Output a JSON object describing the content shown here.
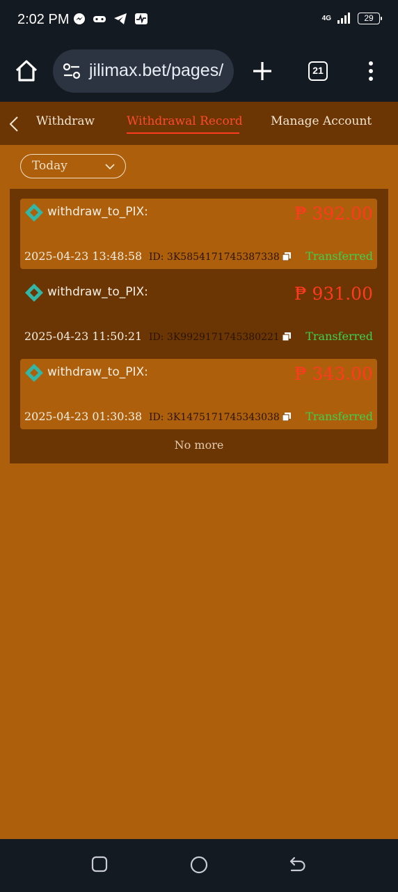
{
  "status_bar": {
    "time": "2:02 PM",
    "network": "4G",
    "battery": "29",
    "notification_icons": [
      "messenger-icon",
      "gamepad-icon",
      "telegram-icon",
      "activity-icon"
    ]
  },
  "browser": {
    "url": "jilimax.bet/pages/",
    "tab_count": "21"
  },
  "header": {
    "tabs": [
      {
        "label": "Withdraw"
      },
      {
        "label": "Withdrawal Record"
      },
      {
        "label": "Manage Account"
      }
    ],
    "active_tab": 1
  },
  "filter": {
    "selected": "Today"
  },
  "records": [
    {
      "method": "withdraw_to_PIX:",
      "amount": "₱ 392.00",
      "datetime": "2025-04-23 13:48:58",
      "id": "ID: 3K5854171745387338",
      "status": "Transferred"
    },
    {
      "method": "withdraw_to_PIX:",
      "amount": "₱ 931.00",
      "datetime": "2025-04-23 11:50:21",
      "id": "ID: 3K9929171745380221",
      "status": "Transferred"
    },
    {
      "method": "withdraw_to_PIX:",
      "amount": "₱ 343.00",
      "datetime": "2025-04-23 01:30:38",
      "id": "ID: 3K1475171745343038",
      "status": "Transferred"
    }
  ],
  "footer": {
    "no_more": "No more"
  },
  "colors": {
    "page_bg": "#ad5f0c",
    "panel_bg": "#6b3604",
    "accent": "#ff3a1e",
    "status_green": "#3cd24f",
    "pix_icon": "#32b7a6"
  }
}
